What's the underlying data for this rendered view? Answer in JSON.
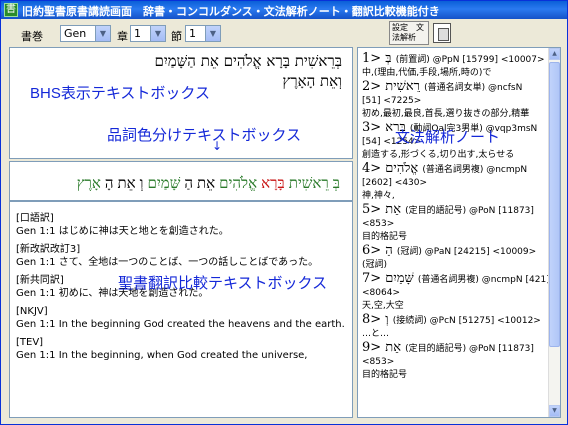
{
  "window": {
    "title": "旧約聖書原書講読画面　辞書・コンコルダンス・文法解析ノート・翻訳比較機能付き",
    "app_icon": "Bible-icon"
  },
  "toolbar": {
    "book_label": "書巻",
    "book_value": "Gen",
    "chapter_label": "章",
    "chapter_value": "1",
    "verse_label": "節",
    "verse_value": "1",
    "settings_label": "設定　文法解析"
  },
  "bhs": {
    "line1": "בְּרֵאשִׁית בָּרָא אֱלֹהִים אֵת הַשָּׁמַיִם",
    "line2": "וְאֵת הָאָרֶץ",
    "label": "BHS表示テキストボックス"
  },
  "pos_label": "品詞色分けテキストボックス",
  "pos_words": [
    {
      "text": "בְּ",
      "color": "#2a7a2a"
    },
    {
      "text": "רֵאשִׁית",
      "color": "#2a7a2a"
    },
    {
      "text": "בָּרָא",
      "color": "#c81414"
    },
    {
      "text": "אֱלֹהִים",
      "color": "#2a7a2a"
    },
    {
      "text": "אֵת",
      "color": "#000000"
    },
    {
      "text": "הַ",
      "color": "#000000"
    },
    {
      "text": "שָּׁמַיִם",
      "color": "#2a7a2a"
    },
    {
      "text": "וְ",
      "color": "#000000"
    },
    {
      "text": "אֵת",
      "color": "#000000"
    },
    {
      "text": "הָ",
      "color": "#000000"
    },
    {
      "text": "אָרֶץ",
      "color": "#2a7a2a"
    }
  ],
  "translations_label": "聖書翻訳比較テキストボックス",
  "translations": [
    {
      "version": "[口語訳]",
      "text": "Gen 1:1 はじめに神は天と地とを創造された。"
    },
    {
      "version": "[新改訳改訂3]",
      "text": "Gen 1:1 さて、全地は一つのことば、一つの話しことばであった。"
    },
    {
      "version": "[新共同訳]",
      "text": "Gen 1:1 初めに、神は天地を創造された。"
    },
    {
      "version": "[NKJV]",
      "text": "Gen 1:1 In the beginning God created the heavens and the earth."
    },
    {
      "version": "[TEV]",
      "text": "Gen 1:1 In the beginning, when God created the universe,"
    }
  ],
  "grammar_label": "文法解析ノート",
  "grammar": [
    {
      "head": "1> בְּ",
      "desc": "(前置詞) @PpN [15799] <10007>"
    },
    {
      "head": "",
      "desc": "中,(理由,代価,手段,場所,時の)で"
    },
    {
      "head": "2> רֵאשִׁית",
      "desc": "(普通名詞女単) @ncfsN"
    },
    {
      "head": "",
      "desc": "[51] <7225>"
    },
    {
      "head": "",
      "desc": "初め,最初,最良,首長,選り抜きの部分,精華"
    },
    {
      "head": "3> בָּרָא",
      "desc": "(動詞Qal完3男単) @vqp3msN"
    },
    {
      "head": "",
      "desc": "[54] <1254>"
    },
    {
      "head": "",
      "desc": "創造する,形づくる,切り出す,太らせる"
    },
    {
      "head": "4> אֱלֹהִים",
      "desc": "(普通名詞男複) @ncmpN"
    },
    {
      "head": "",
      "desc": "[2602] <430>"
    },
    {
      "head": "",
      "desc": "神,神々,"
    },
    {
      "head": "5> אֵת",
      "desc": "(定目的語記号) @PoN [11873]"
    },
    {
      "head": "",
      "desc": "<853>"
    },
    {
      "head": "",
      "desc": "目的格記号"
    },
    {
      "head": "6> הַ",
      "desc": "(冠詞) @PaN [24215] <10009>"
    },
    {
      "head": "",
      "desc": "(冠詞)"
    },
    {
      "head": "7> שָּׁמַיִם",
      "desc": "(普通名詞男複) @ncmpN [421]"
    },
    {
      "head": "",
      "desc": "<8064>"
    },
    {
      "head": "",
      "desc": "天,空,大空"
    },
    {
      "head": "8> וְ",
      "desc": "(接続詞) @PcN [51275] <10012>"
    },
    {
      "head": "",
      "desc": "…と…"
    },
    {
      "head": "9> אֵת",
      "desc": "(定目的語記号) @PoN [11873]"
    },
    {
      "head": "",
      "desc": "<853>"
    },
    {
      "head": "",
      "desc": "目的格記号"
    }
  ]
}
